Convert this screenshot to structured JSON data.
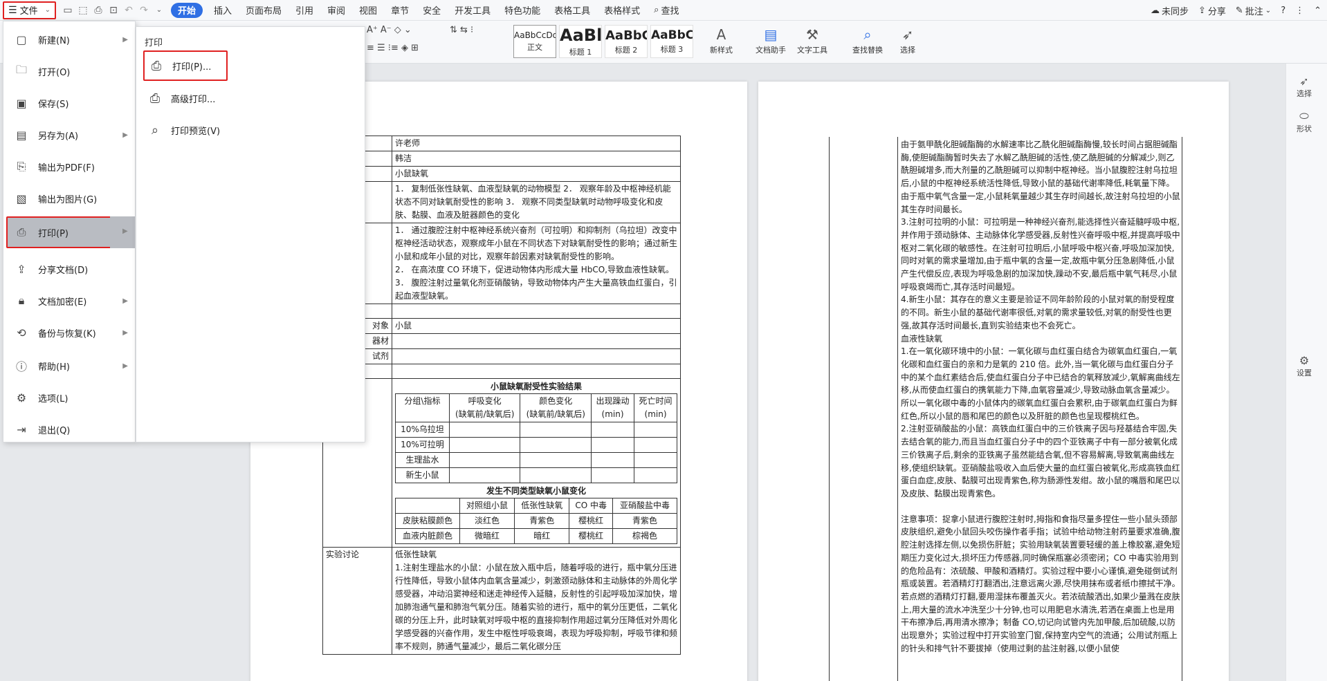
{
  "menubar": {
    "file_label": "文件",
    "tabs": [
      "开始",
      "插入",
      "页面布局",
      "引用",
      "审阅",
      "视图",
      "章节",
      "安全",
      "开发工具",
      "特色功能",
      "表格工具",
      "表格样式"
    ],
    "search_label": "查找",
    "right": {
      "sync": "未同步",
      "share": "分享",
      "comment": "批注"
    }
  },
  "ribbon": {
    "styles": [
      {
        "sample": "AaBbCcDd",
        "label": "正文"
      },
      {
        "sample": "AaBl",
        "label": "标题 1"
      },
      {
        "sample": "AaBbC",
        "label": "标题 2"
      },
      {
        "sample": "AaBbC",
        "label": "标题 3"
      }
    ],
    "new_style": "新样式",
    "doc_assist": "文档助手",
    "text_tools": "文字工具",
    "find_replace": "查找替换",
    "select": "选择"
  },
  "file_menu": {
    "items": [
      {
        "icon": "new-doc-icon",
        "label": "新建(N)",
        "has_sub": true
      },
      {
        "icon": "folder-icon",
        "label": "打开(O)",
        "has_sub": false
      },
      {
        "icon": "save-icon",
        "label": "保存(S)",
        "has_sub": false
      },
      {
        "icon": "save-as-icon",
        "label": "另存为(A)",
        "has_sub": true
      },
      {
        "icon": "pdf-icon",
        "label": "输出为PDF(F)",
        "has_sub": false
      },
      {
        "icon": "image-icon",
        "label": "输出为图片(G)",
        "has_sub": false
      },
      {
        "icon": "printer-icon",
        "label": "打印(P)",
        "has_sub": true
      },
      {
        "icon": "share-icon",
        "label": "分享文档(D)",
        "has_sub": false
      },
      {
        "icon": "lock-icon",
        "label": "文档加密(E)",
        "has_sub": true
      },
      {
        "icon": "backup-icon",
        "label": "备份与恢复(K)",
        "has_sub": true
      },
      {
        "icon": "help-icon",
        "label": "帮助(H)",
        "has_sub": true
      },
      {
        "icon": "options-icon",
        "label": "选项(L)",
        "has_sub": false
      },
      {
        "icon": "exit-icon",
        "label": "退出(Q)",
        "has_sub": false
      }
    ]
  },
  "print_submenu": {
    "title": "打印",
    "items": [
      {
        "label": "打印(P)..."
      },
      {
        "label": "高级打印..."
      },
      {
        "label": "打印预览(V)"
      }
    ]
  },
  "page1": {
    "rows": [
      {
        "k": "",
        "v": "许老师"
      },
      {
        "k": "",
        "v": "韩洁"
      },
      {
        "k": "",
        "v": "小鼠缺氧"
      },
      {
        "k": "",
        "v": "1．  复制低张性缺氧、血液型缺氧的动物模型 2．  观察年龄及中枢神经机能状态不同对缺氧耐受性的影响 3．    观察不同类型缺氧时动物呼吸变化和皮肤、黏膜、血液及脏器颜色的变化"
      },
      {
        "k": "",
        "v_lines": [
          "1．  通过腹腔注射中枢神经系统兴奋剂（可拉明）和抑制剂（乌拉坦）改变中枢神经活动状态，观察成年小鼠在不同状态下对缺氧耐受性的影响；通过新生小鼠和成年小鼠的对比，观察年龄因素对缺氧耐受性的影响。",
          "2．  在高浓度 CO 环境下，促进动物体内形成大量 HbCO,导致血液性缺氧。",
          "3．  腹腔注射过量氧化剂亚硝酸钠，导致动物体内产生大量高铁血红蛋白，引起血液型缺氧。"
        ]
      },
      {
        "k": "",
        "v": ""
      },
      {
        "k": "对象",
        "v": "小鼠"
      },
      {
        "k": "器材",
        "v": ""
      },
      {
        "k": "试剂",
        "v": ""
      },
      {
        "k": "",
        "v": ""
      }
    ],
    "table1": {
      "title": "小鼠缺氧耐受性实验结果",
      "headers": [
        "分组\\指标",
        "呼吸变化\n(缺氧前/缺氧后)",
        "颜色变化\n(缺氧前/缺氧后)",
        "出现躁动\n(min)",
        "死亡时间\n(min)"
      ],
      "rows": [
        "10%乌拉坦",
        "10%可拉明",
        "生理盐水",
        "新生小鼠"
      ]
    },
    "table2": {
      "title": "发生不同类型缺氧小鼠变化",
      "headers": [
        "",
        "对照组小鼠",
        "低张性缺氧",
        "CO 中毒",
        "亚硝酸盐中毒"
      ],
      "rows": [
        [
          "皮肤粘膜颜色",
          "淡红色",
          "青紫色",
          "樱桃红",
          "青紫色"
        ],
        [
          "血液内脏颜色",
          "微暗红",
          "暗红",
          "樱桃红",
          "棕褐色"
        ]
      ]
    },
    "discussion_label": "实验讨论",
    "discussion_lines": [
      "低张性缺氧",
      "1.注射生理盐水的小鼠：小鼠在放入瓶中后，随着呼吸的进行，瓶中氧分压进行性降低，导致小鼠体内血氧含量减少，刺激颈动脉体和主动脉体的外周化学感受器，冲动沿窦神经和迷走神经传入延髓，反射性的引起呼吸加深加快，增加肺泡通气量和肺泡气氧分压。随着实验的进行，瓶中的氧分压更低，二氧化碳的分压上升，此时缺氧对呼吸中枢的直接抑制作用超过氧分压降低对外周化学感受器的兴奋作用，发生中枢性呼吸衰竭，表现为呼吸抑制，呼吸节律和频率不规则，肺通气量减少，最后二氧化碳分压"
    ]
  },
  "page2": {
    "lines": [
      "由于氨甲酰化胆碱酯酶的水解速率比乙酰化胆碱酯酶慢,较长时间占据胆碱酯酶,使胆碱酯酶暂时失去了水解乙酰胆碱的活性,使乙酰胆碱的分解减少,则乙酰胆碱增多,而大剂量的乙酰胆碱可以抑制中枢神经。当小鼠腹腔注射乌拉坦后,小鼠的中枢神经系统活性降低,导致小鼠的基础代谢率降低,耗氧量下降。由于瓶中氧气含量一定,小鼠耗氧量越少其生存时间越长,故注射乌拉坦的小鼠其生存时间最长。",
      "3.注射可拉明的小鼠：可拉明是一种神经兴奋剂,能选择性兴奋延髓呼吸中枢,并作用于颈动脉体、主动脉体化学感受器,反射性兴奋呼吸中枢,并提高呼吸中枢对二氧化碳的敏感性。在注射可拉明后,小鼠呼吸中枢兴奋,呼吸加深加快,同时对氧的需求量增加,由于瓶中氧的含量一定,故瓶中氧分压急剧降低,小鼠产生代偿反应,表现为呼吸急剧的加深加快,躁动不安,最后瓶中氧气耗尽,小鼠呼吸衰竭而亡,其存活时间最短。",
      "4.新生小鼠：其存在的意义主要是验证不同年龄阶段的小鼠对氧的耐受程度的不同。新生小鼠的基础代谢率很低,对氧的需求量较低,对氧的耐受性也更强,故其存活时间最长,直到实验结束也不会死亡。",
      "血液性缺氧",
      "1.在一氧化碳环境中的小鼠：一氧化碳与血红蛋白结合为碳氧血红蛋白,一氧化碳和血红蛋白的亲和力是氧的 210 倍。此外,当一氧化碳与血红蛋白分子中的某个血红素结合后,使血红蛋白分子中已结合的氧释放减少,氧解离曲线左移,从而使血红蛋白的携氧能力下降,血氧容量减少,导致动脉血氧含量减少。所以一氧化碳中毒的小鼠体内的碳氧血红蛋白会累积,由于碳氧血红蛋白为鲜红色,所以小鼠的唇和尾巴的颜色以及肝脏的颜色也呈现樱桃红色。",
      "2.注射亚硝酸盐的小鼠：高铁血红蛋白中的三价铁离子因与羟基结合牢固,失去结合氧的能力,而且当血红蛋白分子中的四个亚铁离子中有一部分被氧化成三价铁离子后,剩余的亚铁离子虽然能结合氧,但不容易解离,导致氧离曲线左移,使组织缺氧。亚硝酸盐吸收入血后使大量的血红蛋白被氧化,形成高铁血红蛋白血症,皮肤、黏膜可出现青紫色,称为肠源性发绀。故小鼠的嘴唇和尾巴以及皮肤、黏膜出现青紫色。",
      "",
      "注意事项：捉拿小鼠进行腹腔注射时,拇指和食指尽量多捏住一些小鼠头颈部皮肤组织,避免小鼠回头咬伤操作者手指；试验中给动物注射药量要求准确,腹腔注射选择左侧,以免损伤肝脏；实验用缺氧装置要轻缓的盖上橡胶塞,避免短期压力变化过大,损坏压力传感器,同时确保瓶塞必须密闭；CO 中毒实验用到的危险品有：浓硫酸、甲酸和酒精灯。实验过程中要小心谨慎,避免碰倒试剂瓶或装置。若酒精灯打翻洒出,注意远离火源,尽快用抹布或者纸巾擦拭干净。若点燃的酒精灯打翻,要用湿抹布覆盖灭火。若浓硫酸洒出,如果少量溅在皮肤上,用大量的流水冲洗至少十分钟,也可以用肥皂水清洗,若洒在桌面上也是用干布擦净后,再用清水擦净；制备 CO,切记向试管内先加甲酸,后加硫酸,以防出现意外；实验过程中打开实验室门窗,保持室内空气的流通；公用试剂瓶上的针头和排气针不要拔掉（使用过剩的盐注射器,以便小鼠使"
    ]
  },
  "rightbar": {
    "select": "选择",
    "shape": "形状",
    "settings": "设置"
  }
}
